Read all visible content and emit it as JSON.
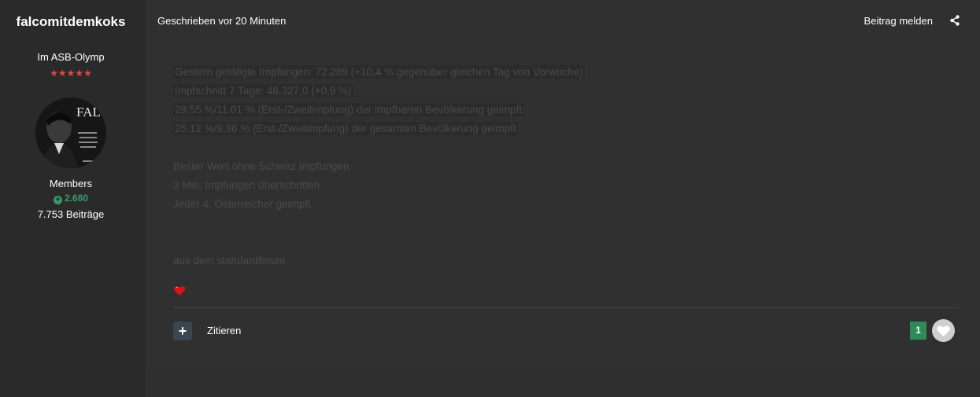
{
  "author": {
    "username": "falcomitdemkoks",
    "title": "Im ASB-Olymp",
    "stars": "★★★★★",
    "group": "Members",
    "reputation": "2.680",
    "post_count": "7.753 Beiträge",
    "avatar_text": "FALCO"
  },
  "post": {
    "meta": "Geschrieben vor 20 Minuten",
    "report_label": "Beitrag melden",
    "lines": [
      "Gestern getätigte Impfungen: 72.289 (+10,4 % gegenüber gleichen Tag von Vorwoche)",
      "Impfschnitt 7 Tage: 48.327,0 (+0,9 %)",
      "29.55 %/11.01 % (Erst-/Zweitimpfung) der impfbaren Bevölkerung geimpft",
      "25.12 %/9,36 % (Erst-/Zweitimpfung) der gesamten Bevölkerung geimpft",
      "Bester Wert ohne Schwaz Impfungen",
      "3 Mio. Impfungen überschritten",
      "Jeder 4. Österreicher geimpft",
      "aus dem standardforum"
    ],
    "quote_label": "Zitieren",
    "like_count": "1"
  },
  "colors": {
    "background": "#2a2a2a",
    "post_background": "#303030",
    "reputation_green": "#3b9a6a",
    "like_badge": "#2e8b57",
    "stars_red": "#e04848"
  },
  "icons": {
    "share": "share-icon",
    "plus": "plus-icon",
    "heart": "heart-icon",
    "reputation": "plus-circle-icon"
  }
}
